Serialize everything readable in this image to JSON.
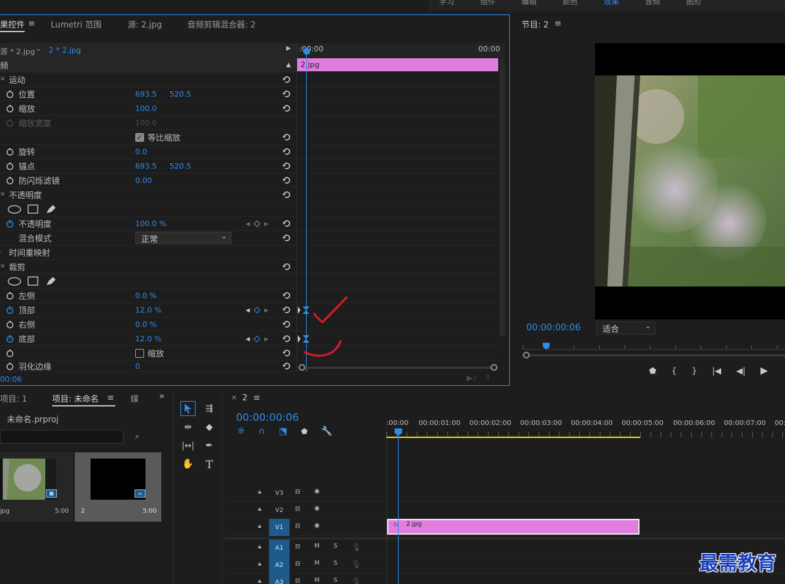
{
  "top_menu": {
    "items": [
      "学习",
      "组件",
      "编辑",
      "颜色",
      "效果",
      "音频",
      "图形"
    ]
  },
  "effect_controls": {
    "tabs": {
      "active": "果控件",
      "lumetri": "Lumetri 范围",
      "source": "源: 2.jpg",
      "mixer": "音频剪辑混合器: 2"
    },
    "master_clip": "源 * 2.jpg",
    "sequence_clip": "2 * 2.jpg",
    "timeline": {
      "start": ":00:00",
      "end": "00:00",
      "clip_label": "2.jpg"
    },
    "video_header": "频",
    "motion": "运动",
    "position_label": "位置",
    "position_x": "693.5",
    "position_y": "520.5",
    "scale_label": "缩放",
    "scale_value": "100.0",
    "scale_width_label": "缩放宽度",
    "scale_width_value": "100.0",
    "uniform_scale_label": "等比缩放",
    "rotation_label": "旋转",
    "rotation_value": "0.0",
    "anchor_label": "锚点",
    "anchor_x": "693.5",
    "anchor_y": "520.5",
    "flicker_label": "防闪烁滤镜",
    "flicker_value": "0.00",
    "opacity_section": "不透明度",
    "opacity_label": "不透明度",
    "opacity_value": "100.0 %",
    "blend_label": "混合模式",
    "blend_value": "正常",
    "time_remap": "时间重映射",
    "crop_section": "裁剪",
    "left_label": "左侧",
    "left_value": "0.0 %",
    "top_label": "顶部",
    "top_value": "12.0 %",
    "right_label": "右侧",
    "right_value": "0.0 %",
    "bottom_label": "底部",
    "bottom_value": "12.0 %",
    "zoom_label": "缩放",
    "feather_label": "羽化边缘",
    "feather_value": "0",
    "current_time": "00:06"
  },
  "program": {
    "title": "节目: 2",
    "timecode": "00:00:00:06",
    "fit": "适合"
  },
  "project": {
    "tab1": "项目: 1",
    "tab2": "项目: 未命名",
    "tab3": "媒",
    "project_file": "未命名.prproj",
    "items": [
      {
        "name": "jpg",
        "duration": "5:00"
      },
      {
        "name": "2",
        "duration": "5:00"
      }
    ]
  },
  "sequence": {
    "name": "2",
    "timecode": "00:00:00:06",
    "ruler": [
      ":00:00",
      "00:00:01:00",
      "00:00:02:00",
      "00:00:03:00",
      "00:00:04:00",
      "00:00:05:00",
      "00:00:06:00",
      "00:00:07:00",
      "00:0"
    ],
    "clip_label": "2.jpg",
    "tracks": [
      "V3",
      "V2",
      "V1",
      "A1",
      "A2",
      "A3"
    ],
    "mute": "M",
    "solo": "S"
  },
  "watermark": "最需教育",
  "colors": {
    "accent": "#2d8ceb",
    "clip": "#e27de0",
    "annotation": "#e0192b"
  }
}
